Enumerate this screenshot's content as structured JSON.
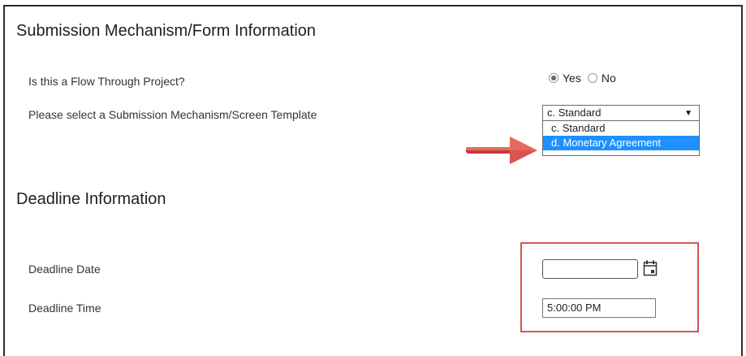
{
  "submission": {
    "heading": "Submission Mechanism/Form Information",
    "flow_through_label": "Is this a Flow Through Project?",
    "radio_yes": "Yes",
    "radio_no": "No",
    "radio_selected": "Yes",
    "template_label": "Please select a Submission Mechanism/Screen Template",
    "template_selected": "c. Standard",
    "template_options": [
      "c. Standard",
      "d. Monetary Agreement"
    ],
    "highlighted_option": "d. Monetary Agreement"
  },
  "deadline": {
    "heading": "Deadline Information",
    "date_label": "Deadline Date",
    "date_value": "",
    "time_label": "Deadline Time",
    "time_value": "5:00:00 PM"
  },
  "colors": {
    "callout_red": "#d9534f",
    "highlight_blue": "#1e90ff"
  },
  "icons": {
    "dropdown_arrow": "caret-down-icon",
    "calendar": "calendar-icon",
    "callout_arrow": "red-arrow-right-icon"
  }
}
